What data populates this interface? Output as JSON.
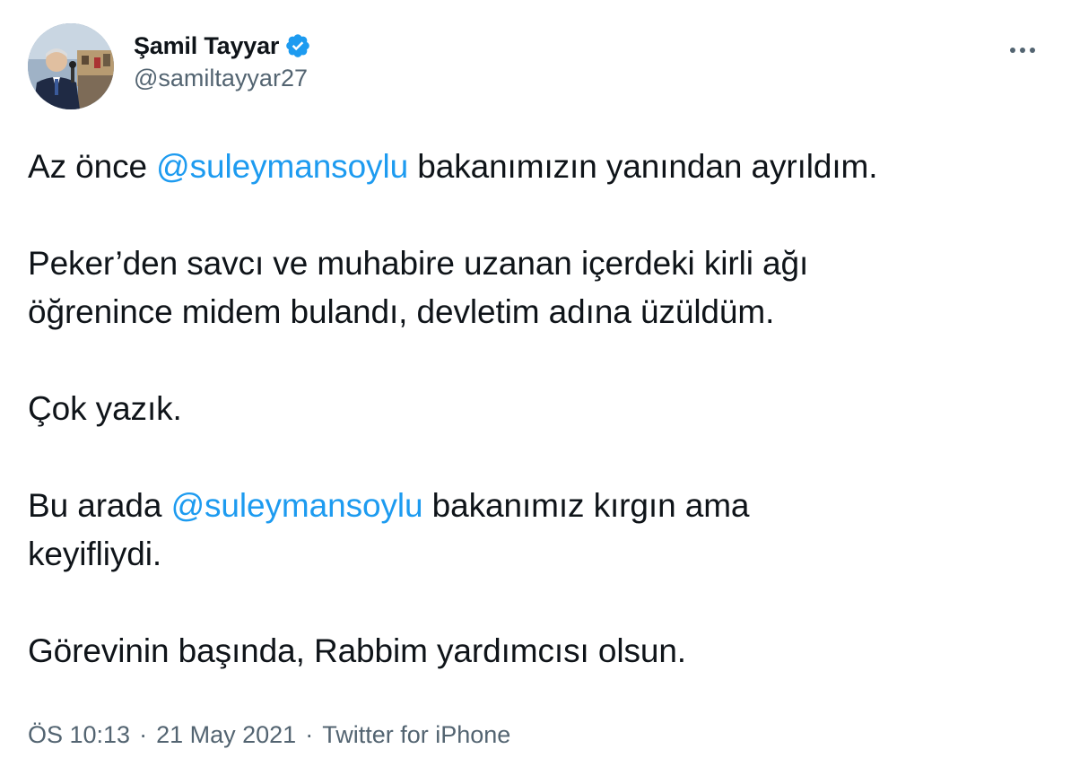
{
  "author": {
    "display_name": "Şamil Tayyar",
    "handle": "@samiltayyar27",
    "verified": true,
    "avatar_icon": "profile-photo"
  },
  "more_icon": "more-horizontal-icon",
  "tweet": {
    "p1": {
      "before": "Az önce ",
      "mention": "@suleymansoylu",
      "after": " bakanımızın yanından ayrıldım."
    },
    "p2": {
      "line1": "Peker’den savcı ve muhabire uzanan içerdeki kirli ağı",
      "line2": "öğrenince midem bulandı, devletim adına üzüldüm."
    },
    "p3": "Çok yazık.",
    "p4": {
      "before": "Bu arada ",
      "mention": "@suleymansoylu",
      "after": " bakanımız kırgın ama",
      "line2": "keyifliydi."
    },
    "p5": "Görevinin başında, Rabbim yardımcısı olsun."
  },
  "meta": {
    "time": "ÖS 10:13",
    "separator": "·",
    "date": "21 May 2021",
    "source": "Twitter for iPhone"
  },
  "colors": {
    "accent": "#1d9bf0",
    "text": "#0f1419",
    "secondary": "#536471"
  }
}
